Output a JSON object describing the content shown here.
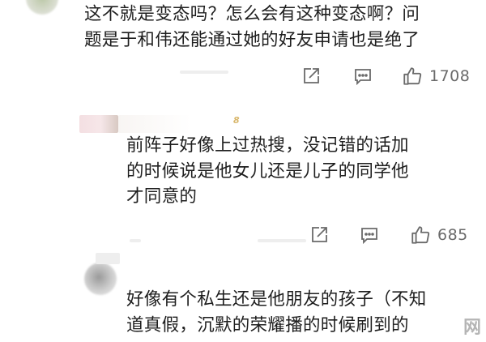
{
  "comments": [
    {
      "text": "这不就是变态吗？怎么会有这种变态啊？问\n题是于和伟还能通过她的好友申请也是绝了",
      "likes": "1708"
    },
    {
      "text": "前阵子好像上过热搜，没记错的话加\n的时候说是他女儿还是儿子的同学他\n才同意的",
      "likes": "685",
      "badge": "8"
    },
    {
      "text": "好像有个私生还是他朋友的孩子（不知\n道真假，沉默的荣耀播的时候刷到的"
    }
  ],
  "watermark": "网",
  "icons": [
    "share-icon",
    "comment-icon",
    "like-icon"
  ]
}
